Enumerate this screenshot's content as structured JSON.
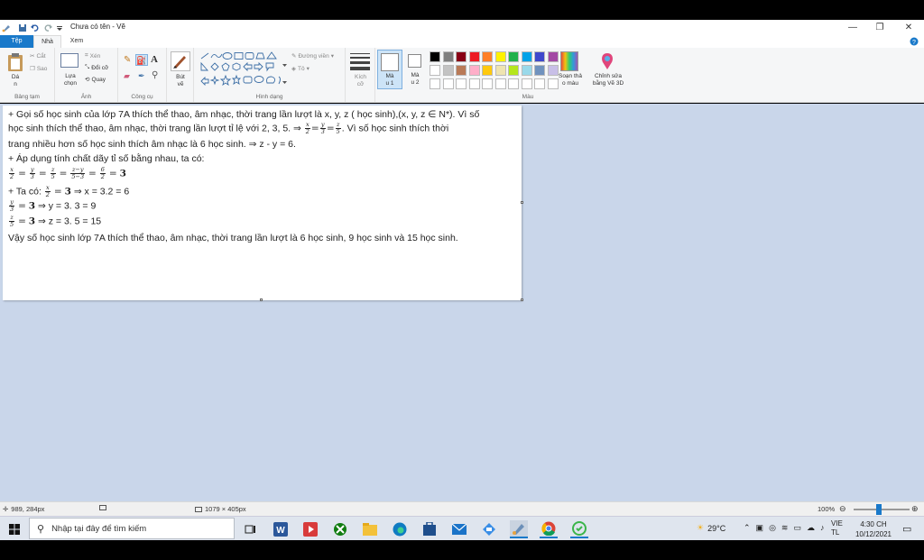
{
  "titlebar": {
    "title": "Chưa có tên - Vẽ",
    "controls": [
      "—",
      "❐",
      "✕"
    ]
  },
  "tabs": [
    {
      "label": "Tệp"
    },
    {
      "label": "Nhà"
    },
    {
      "label": "Xem"
    }
  ],
  "ribbon": {
    "clipboard": {
      "paste": "Dá\nn",
      "cut": "Cắt",
      "copy": "Sao",
      "group": "Bảng tạm"
    },
    "image": {
      "select": "Lựa\nchọn",
      "crop": "Xén",
      "resize": "Đổi cỡ",
      "rotate": "Quay",
      "group": "Ảnh"
    },
    "tools": {
      "group": "Công cụ"
    },
    "brushes": {
      "label": "Bút\nvẽ"
    },
    "shapes": {
      "outline": "Đường viền",
      "fill": "Tô",
      "group": "Hình dạng"
    },
    "size": {
      "label": "Kích\ncỡ"
    },
    "color1": {
      "label": "Mà\nu 1"
    },
    "color2": {
      "label": "Mà\nu 2"
    },
    "colors": {
      "group": "Màu",
      "row1": [
        "#000000",
        "#7f7f7f",
        "#880015",
        "#ed1c24",
        "#ff7f27",
        "#fff200",
        "#22b14c",
        "#00a2e8",
        "#3f48cc",
        "#a349a4"
      ],
      "row2": [
        "#ffffff",
        "#c3c3c3",
        "#b97a57",
        "#ffaec9",
        "#ffc90e",
        "#efe4b0",
        "#b5e61d",
        "#99d9ea",
        "#7092be",
        "#c8bfe7"
      ],
      "row3": [
        "#ffffff",
        "#ffffff",
        "#ffffff",
        "#ffffff",
        "#ffffff",
        "#ffffff",
        "#ffffff",
        "#ffffff",
        "#ffffff",
        "#ffffff"
      ]
    },
    "edit_colors": {
      "label": "Soạn thả\no màu"
    },
    "paint3d": {
      "label": "Chỉnh sửa\nbằng Vẽ 3D"
    }
  },
  "canvas": {
    "line1": "+ Gọi số học sinh của lớp 7A thích thể thao, âm nhạc, thời trang lần lượt là x, y, z ( học sinh),(x, y, z ∈ N*). Vì số",
    "line2a": "học sinh thích thể thao, âm nhạc, thời trang lần lượt tỉ lệ với 2, 3, 5. ⇒",
    "line2b": ". Vì số học sinh thích thời",
    "line3": "trang nhiều hơn số học sinh thích âm nhạc là 6 học sinh. ⇒ z - y = 6.",
    "line4": "+ Áp dụng tính chất dãy tỉ số bằng nhau, ta có:",
    "line6a": "+ Ta có:",
    "line6b": "⇒ x = 3.2 = 6",
    "line7b": "⇒ y = 3. 3 = 9",
    "line8b": "⇒ z = 3. 5 = 15",
    "line9": "Vậy số học sinh lớp 7A thích thể thao, âm nhạc, thời trang lần lượt là 6 học sinh, 9 học sinh và 15 học sinh.",
    "math": {
      "x": "x",
      "y": "y",
      "z": "z",
      "two": "2",
      "three": "3",
      "five": "5",
      "six": "6",
      "zmy": "z−y",
      "fm3": "5−3",
      "eq": "=",
      "bold3": "3"
    }
  },
  "statusbar": {
    "cursor": "989, 284px",
    "size": "1079 × 405px",
    "zoom": "100%",
    "zoom_level": 100
  },
  "taskbar": {
    "search_placeholder": "Nhập tại đây để tìm kiếm",
    "weather": "29°C",
    "lang1": "VIE",
    "lang2": "TL",
    "time": "4:30 CH",
    "date": "10/12/2021"
  }
}
